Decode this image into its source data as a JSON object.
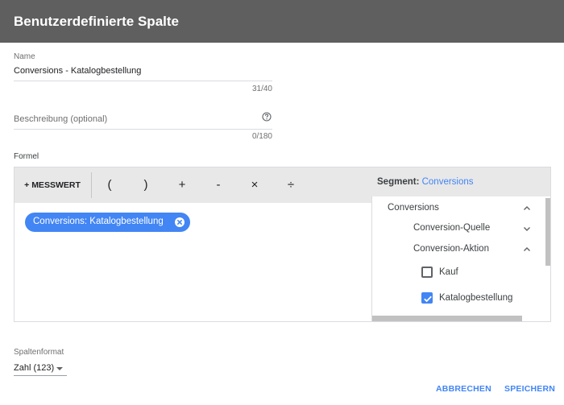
{
  "header": {
    "title": "Benutzerdefinierte Spalte"
  },
  "name_field": {
    "label": "Name",
    "value": "Conversions - Katalogbestellung",
    "counter": "31/40"
  },
  "description_field": {
    "placeholder": "Beschreibung (optional)",
    "counter": "0/180",
    "help_icon": "help-circle-icon"
  },
  "formula": {
    "label": "Formel",
    "toolbar": {
      "metric_button": "+ MESSWERT",
      "operators": [
        "(",
        ")",
        "+",
        "-",
        "×",
        "÷"
      ]
    },
    "chip": {
      "label": "Conversions: Katalogbestellung",
      "remove_icon": "close-circle-icon"
    }
  },
  "segment": {
    "title": "Segment:",
    "value": "Conversions",
    "tree": [
      {
        "label": "Conversions",
        "icon": "chevron-up-icon"
      },
      {
        "label": "Conversion-Quelle",
        "icon": "chevron-down-icon"
      },
      {
        "label": "Conversion-Aktion",
        "icon": "chevron-up-icon"
      }
    ],
    "options": [
      {
        "label": "Kauf",
        "checked": false
      },
      {
        "label": "Katalogbestellung",
        "checked": true
      }
    ]
  },
  "column_format": {
    "label": "Spaltenformat",
    "value": "Zahl (123)"
  },
  "actions": {
    "cancel": "ABBRECHEN",
    "save": "SPEICHERN"
  },
  "colors": {
    "accent": "#4285f4",
    "header_bg": "#5f5f5f",
    "toolbar_bg": "#e8e8e8"
  }
}
